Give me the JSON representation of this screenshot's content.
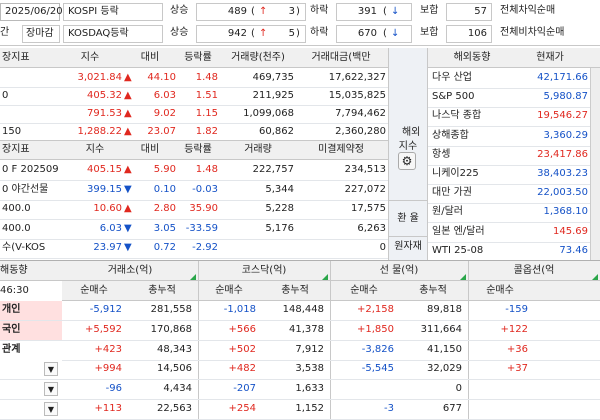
{
  "top": {
    "date": "2025/06/20",
    "row1": {
      "prefix": "",
      "market": "KOSPI 등락",
      "rise_label": "상승",
      "rise": "489",
      "up_arrow": "↑",
      "up_cnt": "3",
      "fall_label": "하락",
      "fall": "391",
      "down_arrow": "↓",
      "flat_label": "보합",
      "flat": "57",
      "right": "전체차익순매"
    },
    "row2": {
      "prefix": "간",
      "status": "장마감",
      "market": "KOSDAQ등락",
      "rise_label": "상승",
      "rise": "942",
      "up_arrow": "↑",
      "up_cnt": "5",
      "fall_label": "하락",
      "fall": "670",
      "down_arrow": "↓",
      "flat_label": "보합",
      "flat": "106",
      "right": "전체비차익순매"
    }
  },
  "index_table": {
    "headers": [
      "장지표",
      "지수",
      "대비",
      "등락률",
      "거래량(천주)",
      "거래대금(백만"
    ],
    "rows": [
      {
        "name": "",
        "value": "3,021.84",
        "arrow": "▲",
        "chg": "44.10",
        "rate": "1.48",
        "vol": "469,735",
        "amt": "17,622,327",
        "dir": "up"
      },
      {
        "name": "0",
        "value": "405.32",
        "arrow": "▲",
        "chg": "6.03",
        "rate": "1.51",
        "vol": "211,925",
        "amt": "15,035,825",
        "dir": "up"
      },
      {
        "name": "",
        "value": "791.53",
        "arrow": "▲",
        "chg": "9.02",
        "rate": "1.15",
        "vol": "1,099,068",
        "amt": "7,794,462",
        "dir": "up"
      },
      {
        "name": "150",
        "value": "1,288.22",
        "arrow": "▲",
        "chg": "23.07",
        "rate": "1.82",
        "vol": "60,862",
        "amt": "2,360,280",
        "dir": "up"
      }
    ]
  },
  "futures_table": {
    "headers": [
      "장지표",
      "지수",
      "대비",
      "등락률",
      "거래량",
      "미결제약정"
    ],
    "rows": [
      {
        "name": "0 F 202509",
        "value": "405.15",
        "arrow": "▲",
        "chg": "5.90",
        "rate": "1.48",
        "vol": "222,757",
        "oi": "234,513",
        "dir": "up"
      },
      {
        "name": "0 야간선물",
        "value": "399.15",
        "arrow": "▼",
        "chg": "0.10",
        "rate": "-0.03",
        "vol": "5,344",
        "oi": "227,072",
        "dir": "dn"
      },
      {
        "name": "400.0",
        "value": "10.60",
        "arrow": "▲",
        "chg": "2.80",
        "rate": "35.90",
        "vol": "5,228",
        "oi": "17,575",
        "dir": "up"
      },
      {
        "name": "400.0",
        "value": "6.03",
        "arrow": "▼",
        "chg": "3.05",
        "rate": "-33.59",
        "vol": "5,176",
        "oi": "6,263",
        "dir": "dn"
      },
      {
        "name": "수(V-KOS",
        "value": "23.97",
        "arrow": "▼",
        "chg": "0.72",
        "rate": "-2.92",
        "vol": "",
        "oi": "0",
        "dir": "dn"
      }
    ]
  },
  "side_labels": {
    "overseas": "해외\n지수",
    "gear": "⚙",
    "fx": "환 율",
    "raw": "원자재"
  },
  "world_table": {
    "headers": [
      "해외동향",
      "현재가"
    ],
    "rows": [
      {
        "name": "다우 산업",
        "value": "42,171.66",
        "dir": "dn"
      },
      {
        "name": "S&P 500",
        "value": "5,980.87",
        "dir": "dn"
      },
      {
        "name": "나스닥 종합",
        "value": "19,546.27",
        "dir": "up"
      },
      {
        "name": "상해종합",
        "value": "3,360.29",
        "dir": "dn"
      },
      {
        "name": "항셍",
        "value": "23,417.86",
        "dir": "up"
      },
      {
        "name": "니케이225",
        "value": "38,403.23",
        "dir": "dn"
      },
      {
        "name": "대만 가권",
        "value": "22,003.50",
        "dir": "dn"
      },
      {
        "name": "원/달러",
        "value": "1,368.10",
        "dir": "dn"
      },
      {
        "name": "일본 엔/달러",
        "value": "145.69",
        "dir": "up"
      },
      {
        "name": "WTI 25-08",
        "value": "73.46",
        "dir": "dn"
      }
    ]
  },
  "investor": {
    "title": "해동향",
    "time": "46:30",
    "groups": [
      "거래소(억)",
      "코스닥(억)",
      "선 물(억)",
      "콜옵션(억"
    ],
    "subheaders": [
      "순매수",
      "총누적",
      "순매수",
      "총누적",
      "순매수",
      "총누적",
      "순매수"
    ],
    "rows": [
      {
        "name": "개인",
        "vals": [
          "-5,912",
          "281,558",
          "-1,018",
          "148,448",
          "+2,158",
          "89,818",
          "-159"
        ],
        "dirs": [
          "dn",
          "blk",
          "dn",
          "blk",
          "up",
          "blk",
          "dn"
        ],
        "tint": "#ffe0e0",
        "dropdown": false
      },
      {
        "name": "국인",
        "vals": [
          "+5,592",
          "170,868",
          "+566",
          "41,378",
          "+1,850",
          "311,664",
          "+122"
        ],
        "dirs": [
          "up",
          "blk",
          "up",
          "blk",
          "up",
          "blk",
          "up"
        ],
        "tint": "#ffe0e0",
        "dropdown": false
      },
      {
        "name": "관계",
        "vals": [
          "+423",
          "48,343",
          "+502",
          "7,912",
          "-3,826",
          "41,150",
          "+36"
        ],
        "dirs": [
          "up",
          "blk",
          "up",
          "blk",
          "dn",
          "blk",
          "up"
        ],
        "tint": "#ffffff",
        "dropdown": false
      },
      {
        "name": "",
        "vals": [
          "+994",
          "14,506",
          "+482",
          "3,538",
          "-5,545",
          "32,029",
          "+37"
        ],
        "dirs": [
          "up",
          "blk",
          "up",
          "blk",
          "dn",
          "blk",
          "up"
        ],
        "tint": "#ffffff",
        "dropdown": true
      },
      {
        "name": "",
        "vals": [
          "-96",
          "4,434",
          "-207",
          "1,633",
          "",
          "0",
          ""
        ],
        "dirs": [
          "dn",
          "blk",
          "dn",
          "blk",
          "blk",
          "blk",
          "blk"
        ],
        "tint": "#ffffff",
        "dropdown": true
      },
      {
        "name": "",
        "vals": [
          "+113",
          "22,563",
          "+254",
          "1,152",
          "-3",
          "677",
          ""
        ],
        "dirs": [
          "up",
          "blk",
          "up",
          "blk",
          "dn",
          "blk",
          "blk"
        ],
        "tint": "#ffffff",
        "dropdown": true
      }
    ]
  }
}
